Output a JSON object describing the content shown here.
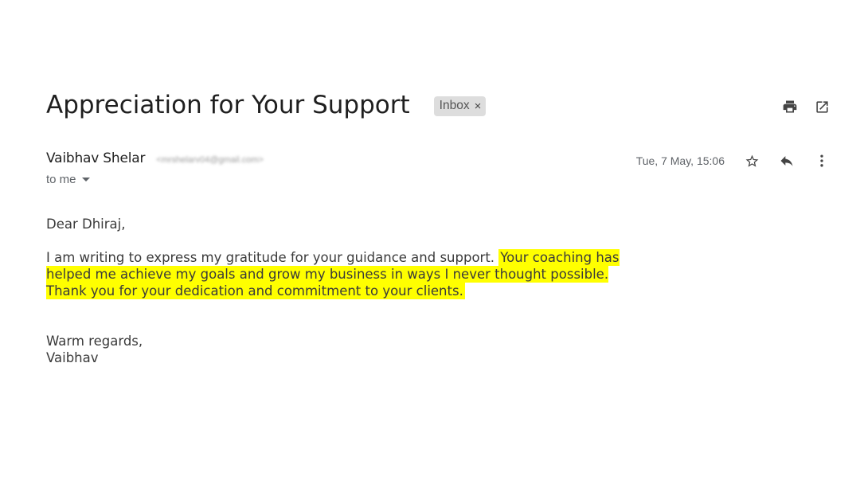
{
  "email": {
    "subject": "Appreciation for Your Support",
    "label": "Inbox",
    "label_remove": "×",
    "sender_name": "Vaibhav Shelar",
    "sender_email": "<mrshelarv04@gmail.com>",
    "recipient": "to me",
    "date": "Tue, 7 May, 15:06",
    "body": {
      "greeting": "Dear Dhiraj,",
      "plain": "I am writing to express my gratitude for your guidance and support.",
      "highlighted": "Your coaching has helped me achieve my goals and grow my business in ways I never thought possible. Thank you for your dedication and commitment to your clients.",
      "closing": "Warm regards,",
      "signature": "Vaibhav"
    }
  },
  "icons": {
    "print": "print-icon",
    "open_new_window": "open-in-new-window-icon",
    "star": "star-icon",
    "reply": "reply-icon",
    "more": "more-vertical-icon",
    "recipient_caret": "caret-down-icon"
  },
  "colors": {
    "highlight": "#ffff00",
    "chip_bg": "#dddddd",
    "icon": "#444444"
  }
}
